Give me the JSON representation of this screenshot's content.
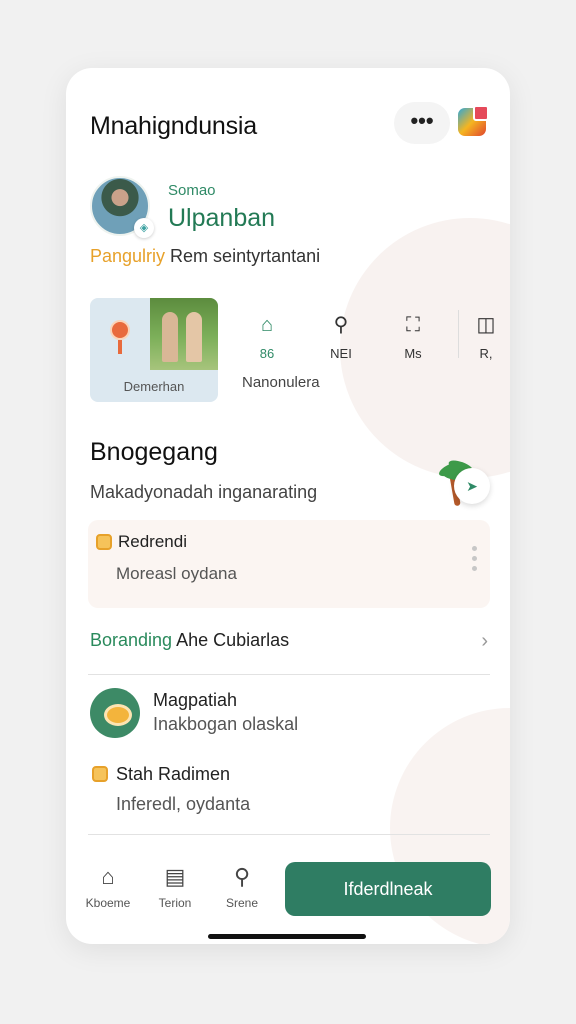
{
  "app": {
    "title": "Mnahigndunsia",
    "more_label": "•••"
  },
  "profile": {
    "subtitle": "Somao",
    "name": "Ulpanban",
    "description_highlight": "Pangulriy",
    "description_rest": " Rem seintyrtantani"
  },
  "tiles": {
    "photo_caption": "Demerhan",
    "caption": "Nanonulera",
    "quick_actions": [
      {
        "label": "86",
        "icon": "bag-icon",
        "glyph": "⌂"
      },
      {
        "label": "NEI",
        "icon": "search-icon",
        "glyph": "⚲"
      },
      {
        "label": "Ms",
        "icon": "puzzle-icon",
        "glyph": "⛶"
      },
      {
        "label": "R,",
        "icon": "chat-icon",
        "glyph": "◫"
      }
    ]
  },
  "section": {
    "title": "Bnogegang",
    "subtitle": "Makadyonadah inganarating",
    "send_glyph": "➤"
  },
  "card": {
    "title": "Redrendi",
    "subtitle": "Moreasl oydana"
  },
  "link": {
    "green": "Boranding",
    "rest": " Ahe Cubiarlas",
    "chevron": "›"
  },
  "list": {
    "title": "Magpatiah",
    "subtitle": "Inakbogan olaskal"
  },
  "task": {
    "title": "Stah Radimen",
    "subtitle": "Inferedl, oydanta"
  },
  "nav": [
    {
      "label": "Kboeme",
      "glyph": "⌂",
      "icon": "home-icon"
    },
    {
      "label": "Terion",
      "glyph": "▤",
      "icon": "list-icon"
    },
    {
      "label": "Srene",
      "glyph": "⚲",
      "icon": "search-icon"
    }
  ],
  "cta": {
    "label": "Ifderdlneak"
  },
  "colors": {
    "accent": "#2f7d63",
    "highlight": "#e7a12a"
  }
}
